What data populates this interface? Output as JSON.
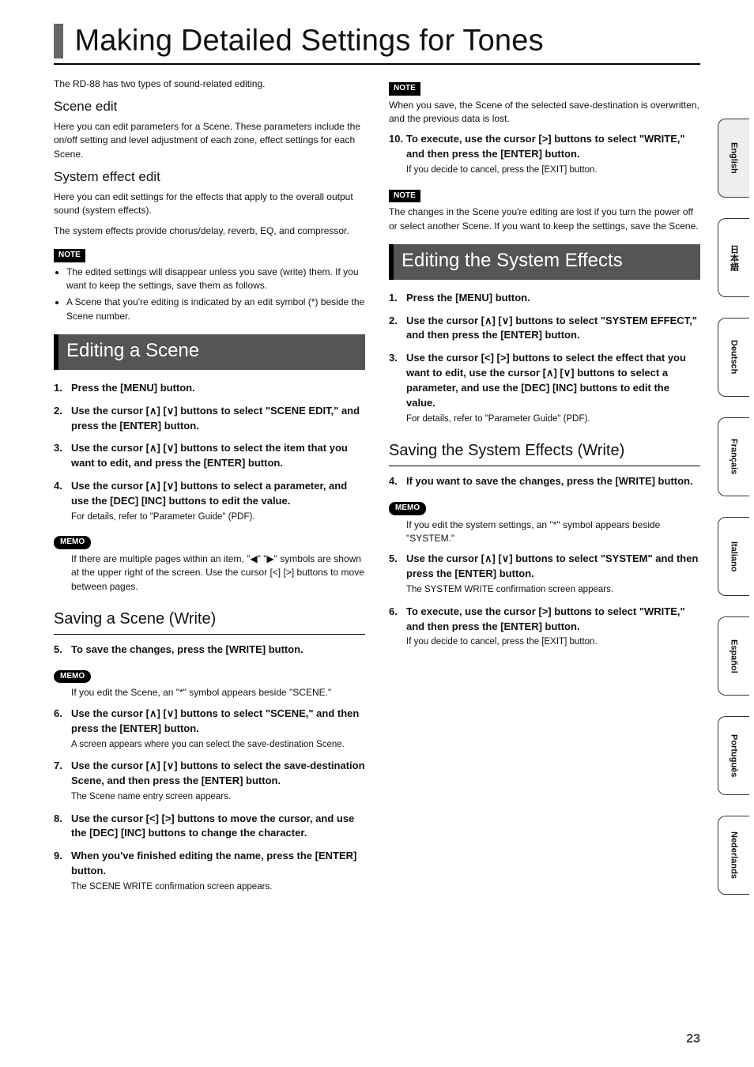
{
  "page_number": "23",
  "title": "Making Detailed Settings for Tones",
  "intro": "The RD-88 has two types of sound-related editing.",
  "scene_edit": {
    "heading": "Scene edit",
    "body": "Here you can edit parameters for a Scene. These parameters include the on/off setting and level adjustment of each zone, effect settings for each Scene."
  },
  "sys_effect_edit": {
    "heading": "System effect edit",
    "body1": "Here you can edit settings for the effects that apply to the overall output sound (system effects).",
    "body2": "The system effects provide chorus/delay, reverb, EQ, and compressor."
  },
  "note_label": "NOTE",
  "memo_label": "MEMO",
  "note1_items": [
    "The edited settings will disappear unless you save (write) them. If you want to keep the settings, save them as follows.",
    "A Scene that you're editing is indicated by an edit symbol (*) beside the Scene number."
  ],
  "editing_scene": {
    "heading": "Editing a Scene",
    "steps": [
      {
        "n": "1.",
        "t": "Press the [MENU] button."
      },
      {
        "n": "2.",
        "t": "Use the cursor [∧] [∨] buttons to select \"SCENE EDIT,\" and press the [ENTER] button."
      },
      {
        "n": "3.",
        "t": "Use the cursor [∧] [∨] buttons to select the item that you want to edit, and press the [ENTER] button."
      },
      {
        "n": "4.",
        "t": "Use the cursor [∧] [∨] buttons to select a parameter, and use the [DEC] [INC] buttons to edit the value.",
        "s": "For details, refer to \"Parameter Guide\" (PDF)."
      }
    ],
    "memo": "If there are multiple pages within an item, \"◀\" \"▶\" symbols are shown at the upper right of the screen. Use the cursor [<] [>] buttons to move between pages."
  },
  "saving_scene": {
    "heading": "Saving a Scene (Write)",
    "step5": {
      "n": "5.",
      "t": "To save the changes, press the [WRITE] button."
    },
    "memo": "If you edit the Scene, an \"*\" symbol appears beside \"SCENE.\"",
    "steps_rest": [
      {
        "n": "6.",
        "t": "Use the cursor [∧] [∨] buttons to select \"SCENE,\" and then press the [ENTER] button.",
        "s": "A screen appears where you can select the save-destination Scene."
      },
      {
        "n": "7.",
        "t": "Use the cursor [∧] [∨] buttons to select the save-destination Scene, and then press the [ENTER] button.",
        "s": "The Scene name entry screen appears."
      },
      {
        "n": "8.",
        "t": "Use the cursor [<] [>] buttons to move the cursor, and use the [DEC] [INC] buttons to change the character."
      },
      {
        "n": "9.",
        "t": "When you've finished editing the name, press the [ENTER] button.",
        "s": "The SCENE WRITE confirmation screen appears."
      }
    ]
  },
  "col2_note1": "When you save, the Scene of the selected save-destination is overwritten, and the previous data is lost.",
  "col2_step10": {
    "n": "10.",
    "t": "To execute, use the cursor [>] buttons to select \"WRITE,\" and then press the [ENTER] button.",
    "s": "If you decide to cancel, press the [EXIT] button."
  },
  "col2_note2": "The changes in the Scene you're editing are lost if you turn the power off or select another Scene. If you want to keep the settings, save the Scene.",
  "editing_sys": {
    "heading": "Editing the System Effects",
    "steps": [
      {
        "n": "1.",
        "t": "Press the [MENU] button."
      },
      {
        "n": "2.",
        "t": "Use the cursor [∧] [∨] buttons to select \"SYSTEM EFFECT,\" and then press the [ENTER] button."
      },
      {
        "n": "3.",
        "t": "Use the cursor [<] [>] buttons to select the effect that you want to edit, use the cursor [∧] [∨] buttons to select a parameter, and use the [DEC] [INC] buttons to edit the value.",
        "s": "For details, refer to \"Parameter Guide\" (PDF)."
      }
    ]
  },
  "saving_sys": {
    "heading": "Saving the System Effects (Write)",
    "step4": {
      "n": "4.",
      "t": "If you want to save the changes, press the [WRITE] button."
    },
    "memo": "If you edit the system settings, an \"*\" symbol appears beside \"SYSTEM.\"",
    "steps_rest": [
      {
        "n": "5.",
        "t": "Use the cursor [∧] [∨] buttons to select \"SYSTEM\" and then press the [ENTER] button.",
        "s": "The SYSTEM WRITE confirmation screen appears."
      },
      {
        "n": "6.",
        "t": "To execute, use the cursor [>] buttons to select \"WRITE,\" and then press the [ENTER] button.",
        "s": "If you decide to cancel, press the [EXIT] button."
      }
    ]
  },
  "langs": [
    "English",
    "日本語",
    "Deutsch",
    "Français",
    "Italiano",
    "Español",
    "Português",
    "Nederlands"
  ]
}
